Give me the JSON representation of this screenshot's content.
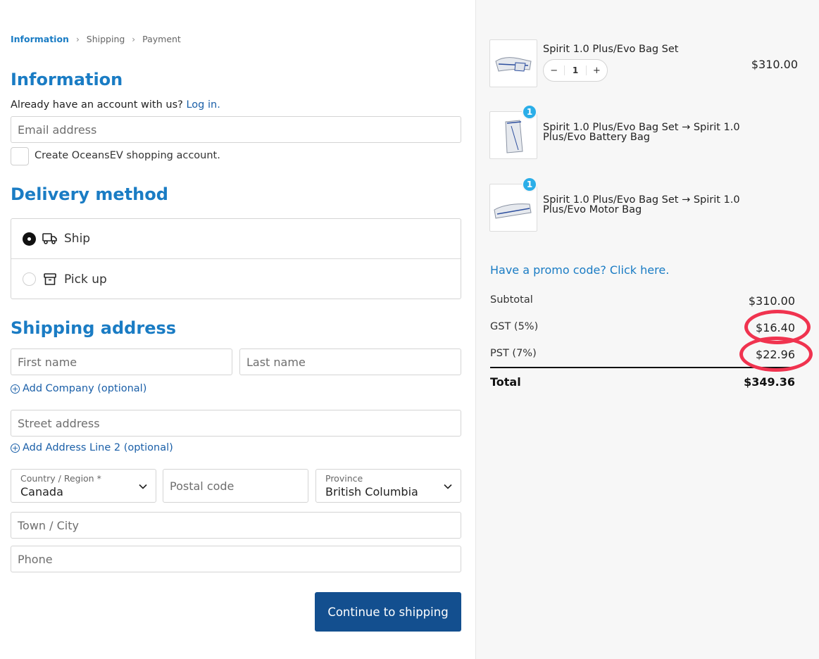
{
  "breadcrumb": {
    "info": "Information",
    "shipping": "Shipping",
    "payment": "Payment",
    "sep": "›"
  },
  "info": {
    "heading": "Information",
    "account_text": "Already have an account with us?",
    "login_link": "Log in.",
    "email_placeholder": "Email address",
    "create_account_label": "Create OceansEV shopping account."
  },
  "delivery": {
    "heading": "Delivery method",
    "options": [
      {
        "label": "Ship",
        "selected": true,
        "icon": "truck-icon"
      },
      {
        "label": "Pick up",
        "selected": false,
        "icon": "archive-box-icon"
      }
    ]
  },
  "shipping": {
    "heading": "Shipping address",
    "first_name_placeholder": "First name",
    "last_name_placeholder": "Last name",
    "add_company": "Add Company (optional)",
    "street_placeholder": "Street address",
    "add_line2": "Add Address Line 2 (optional)",
    "country_label": "Country / Region *",
    "country_value": "Canada",
    "postal_placeholder": "Postal code",
    "province_label": "Province",
    "province_value": "British Columbia",
    "city_placeholder": "Town / City",
    "phone_placeholder": "Phone"
  },
  "continue_button": "Continue to shipping",
  "cart": {
    "items": [
      {
        "name": "Spirit 1.0 Plus/Evo Bag Set",
        "price": "$310.00",
        "quantity": "1",
        "minus": "−",
        "plus": "+"
      },
      {
        "name": "Spirit 1.0 Plus/Evo Bag Set → Spirit 1.0 Plus/Evo Battery Bag",
        "badge": "1"
      },
      {
        "name": "Spirit 1.0 Plus/Evo Bag Set → Spirit 1.0 Plus/Evo Motor Bag",
        "badge": "1"
      }
    ],
    "promo": "Have a promo code? Click here.",
    "subtotal_label": "Subtotal",
    "subtotal_value": "$310.00",
    "gst_label": "GST (5%)",
    "gst_value": "$16.40",
    "pst_label": "PST (7%)",
    "pst_value": "$22.96",
    "total_label": "Total",
    "total_value": "$349.36"
  },
  "colors": {
    "accent": "#1a7cc4",
    "button": "#134f8f",
    "highlight_ring": "#f0334f",
    "badge": "#2baee8"
  }
}
